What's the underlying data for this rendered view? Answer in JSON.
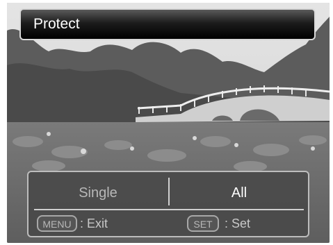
{
  "title": "Protect",
  "options": [
    {
      "label": "Single",
      "selected": false
    },
    {
      "label": "All",
      "selected": true
    }
  ],
  "footer": {
    "menu_key": "MENU",
    "menu_hint": ": Exit",
    "set_key": "SET",
    "set_hint": ": Set"
  }
}
